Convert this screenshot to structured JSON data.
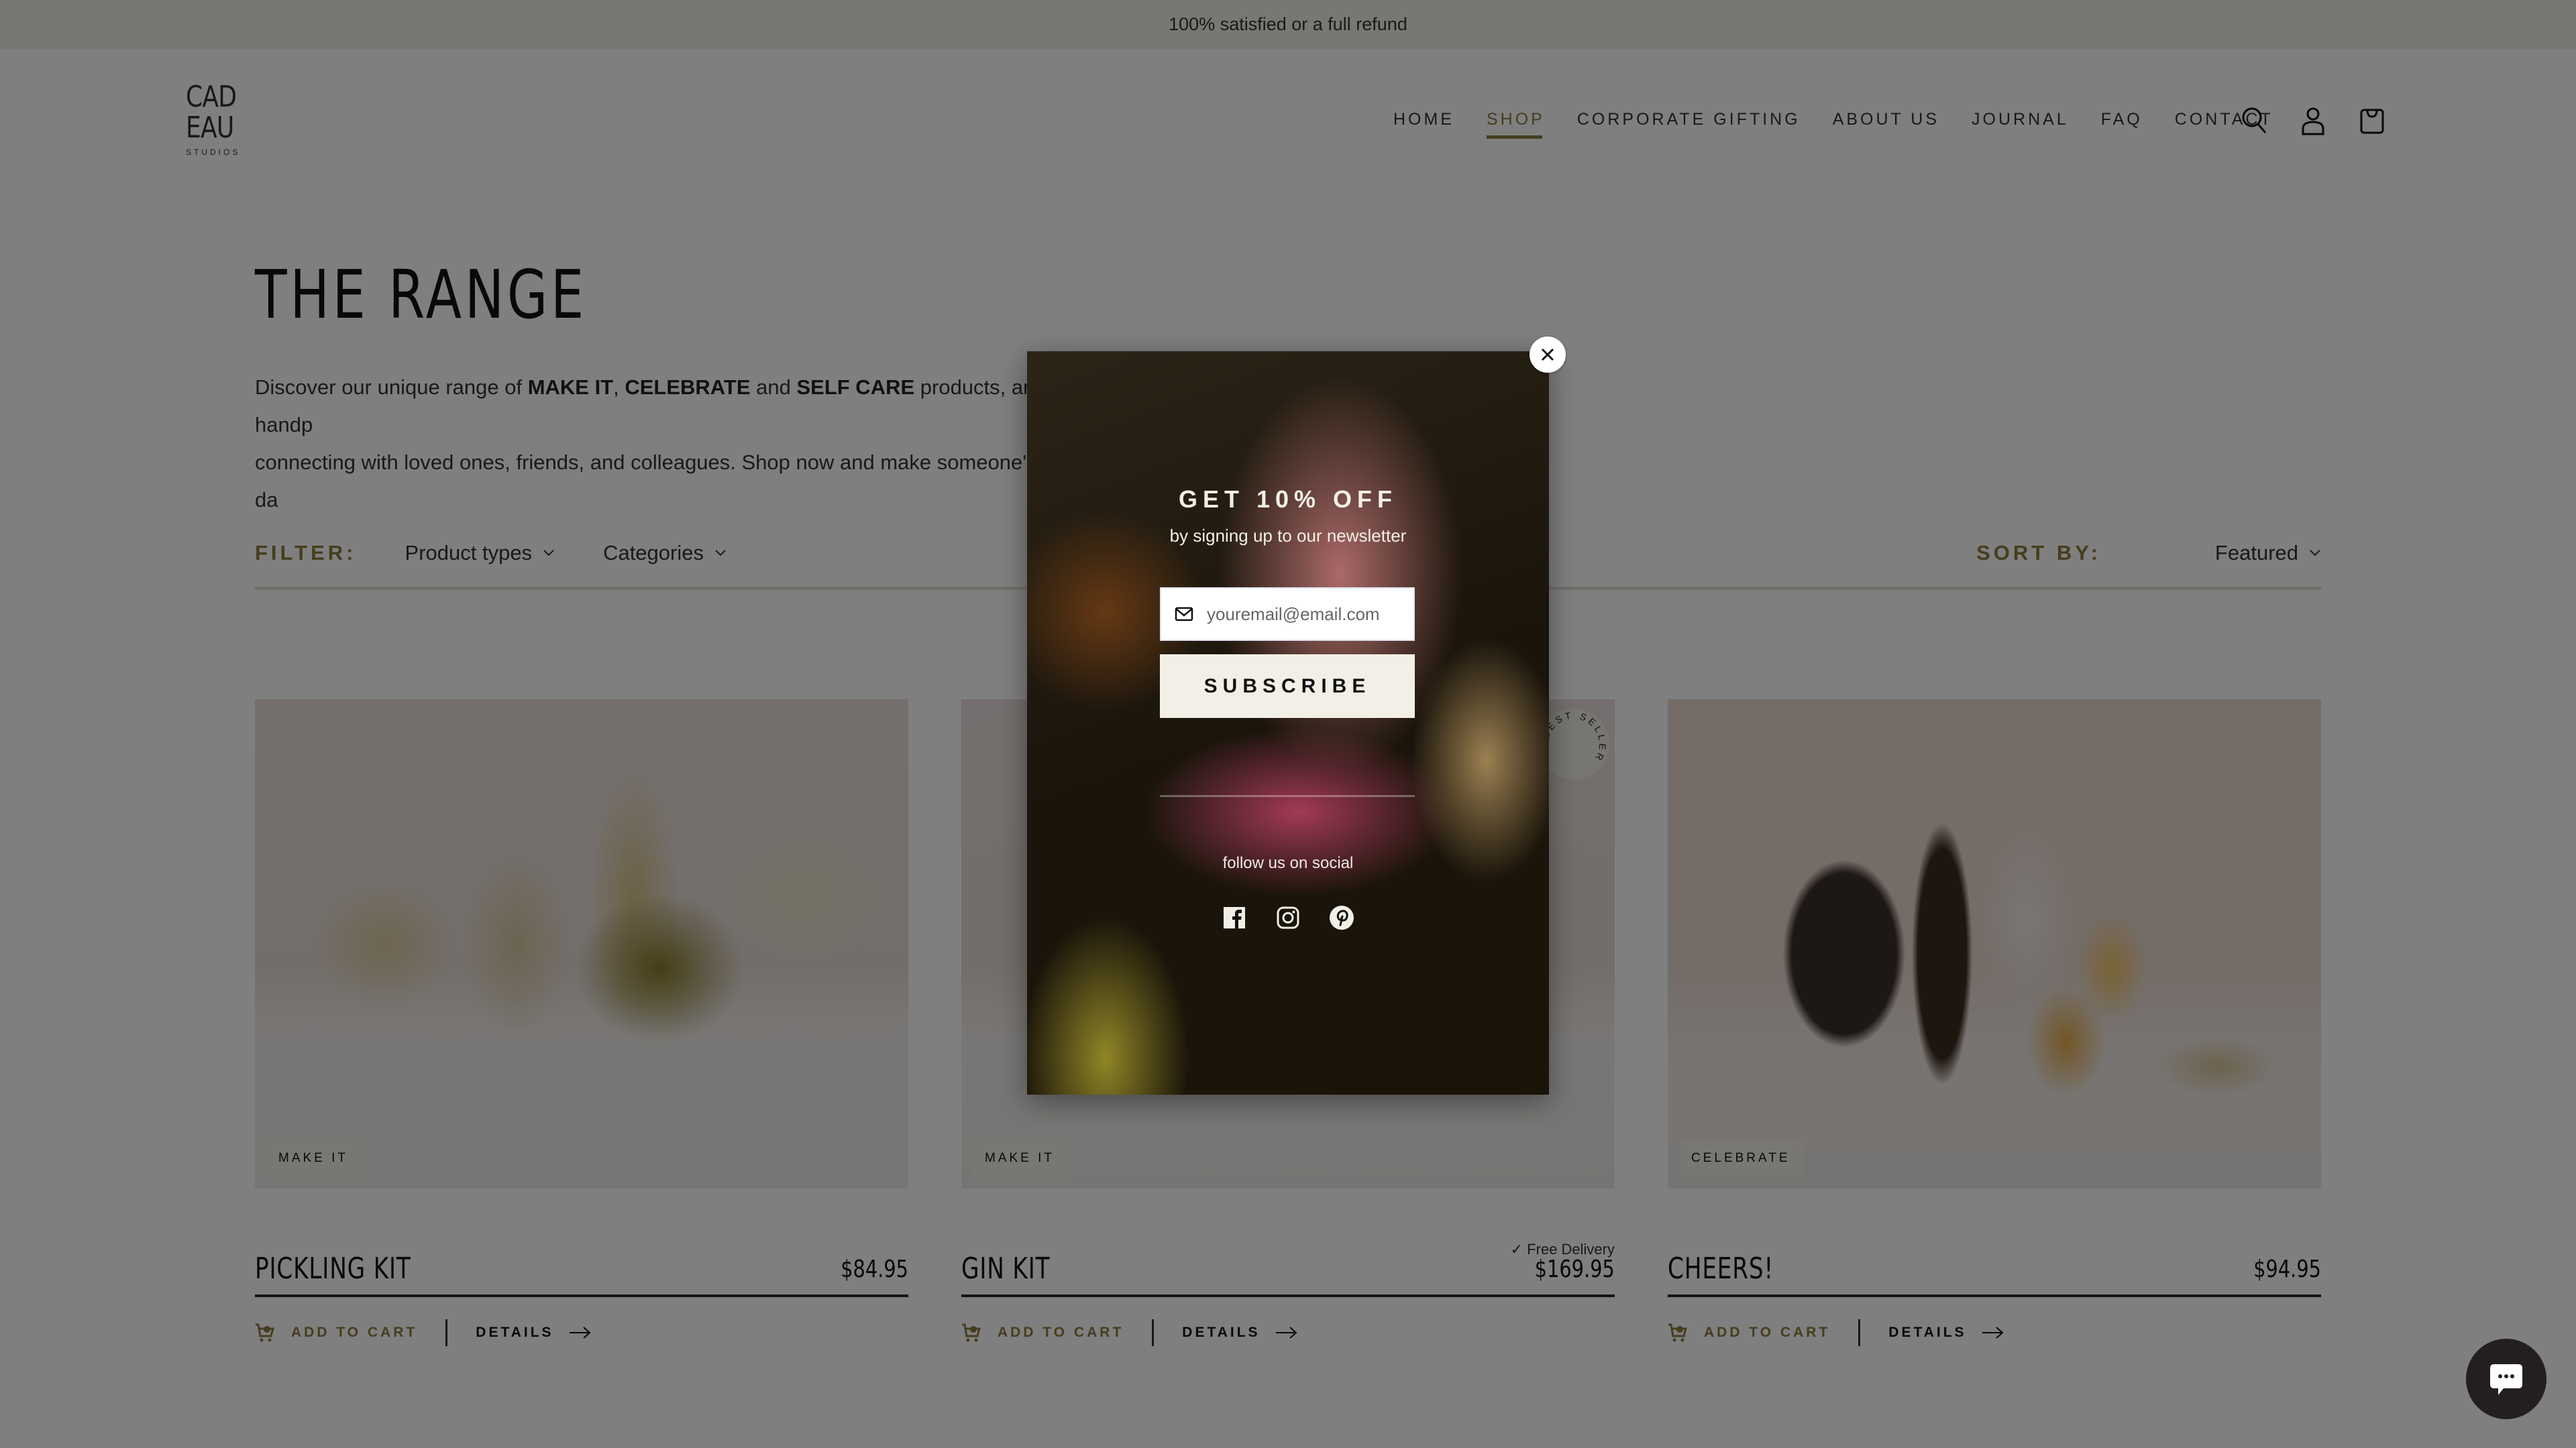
{
  "announcement": "100% satisfied or a full refund",
  "logo": {
    "line1": "CAD",
    "line2": "EAU",
    "line3": "STUDIOS"
  },
  "nav": {
    "items": [
      {
        "label": "HOME",
        "active": false
      },
      {
        "label": "SHOP",
        "active": true
      },
      {
        "label": "CORPORATE GIFTING",
        "active": false
      },
      {
        "label": "ABOUT US",
        "active": false
      },
      {
        "label": "JOURNAL",
        "active": false
      },
      {
        "label": "FAQ",
        "active": false
      },
      {
        "label": "CONTACT",
        "active": false
      }
    ],
    "icons": [
      "search-icon",
      "account-icon",
      "cart-icon"
    ]
  },
  "page": {
    "title": "THE RANGE",
    "description": {
      "p1": "Discover our unique range of ",
      "b1": "MAKE IT",
      "p2": ", ",
      "b2": "CELEBRATE",
      "p3": " and ",
      "b3": "SELF CARE",
      "p4": " products, and handp",
      "line2": "connecting with loved ones, friends, and colleagues. Shop now and make someone's da"
    }
  },
  "filter": {
    "label": "FILTER:",
    "dropdowns": [
      "Product types",
      "Categories"
    ],
    "sort_label": "SORT BY:",
    "sort_value": "Featured"
  },
  "products": [
    {
      "title": "PICKLING KIT",
      "price": "$84.95",
      "tag": "MAKE IT",
      "free_delivery": null,
      "badge": null,
      "add_to_cart": "ADD TO CART",
      "details": "DETAILS"
    },
    {
      "title": "GIN KIT",
      "price": "$169.95",
      "tag": "MAKE IT",
      "free_delivery": "Free Delivery",
      "badge": "BEST SELLER",
      "add_to_cart": "ADD TO CART",
      "details": "DETAILS"
    },
    {
      "title": "CHEERS!",
      "price": "$94.95",
      "tag": "CELEBRATE",
      "free_delivery": null,
      "badge": null,
      "add_to_cart": "ADD TO CART",
      "details": "DETAILS"
    }
  ],
  "popup": {
    "headline": "GET 10% OFF",
    "subline": "by signing up to our newsletter",
    "email_placeholder": "youremail@email.com",
    "email_value": "",
    "subscribe_label": "SUBSCRIBE",
    "follow_label": "follow us on social",
    "socials": [
      "facebook",
      "instagram",
      "pinterest"
    ]
  },
  "colors": {
    "accent": "#8a7a3a",
    "announcement_bg": "#f1efe8",
    "subscribe_bg": "#f2efe6",
    "chat_bg": "#231f20"
  }
}
